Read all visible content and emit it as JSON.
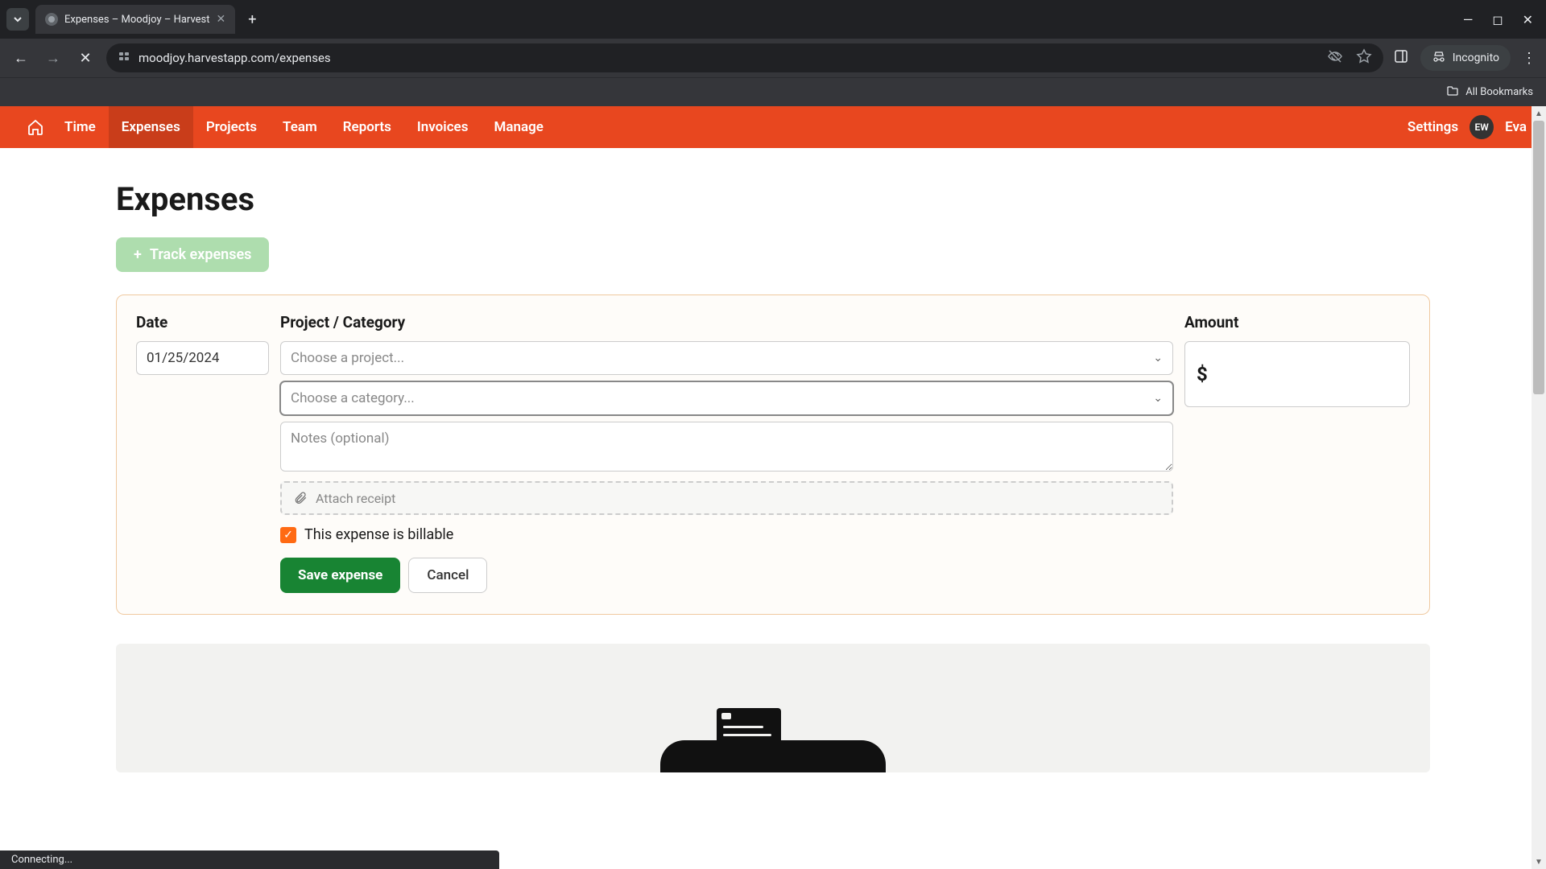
{
  "browser": {
    "tab_title": "Expenses – Moodjoy – Harvest",
    "url": "moodjoy.harvestapp.com/expenses",
    "incognito_label": "Incognito",
    "all_bookmarks": "All Bookmarks",
    "status_text": "Connecting..."
  },
  "nav": {
    "items": [
      "Time",
      "Expenses",
      "Projects",
      "Team",
      "Reports",
      "Invoices",
      "Manage"
    ],
    "active_index": 1,
    "settings": "Settings",
    "avatar_initials": "EW",
    "username": "Eva"
  },
  "page": {
    "title": "Expenses",
    "track_button": "Track expenses"
  },
  "form": {
    "labels": {
      "date": "Date",
      "project_category": "Project / Category",
      "amount": "Amount"
    },
    "date_value": "01/25/2024",
    "project_placeholder": "Choose a project...",
    "category_placeholder": "Choose a category...",
    "notes_placeholder": "Notes (optional)",
    "attach_label": "Attach receipt",
    "amount_currency": "$",
    "billable_label": "This expense is billable",
    "billable_checked": true,
    "save_label": "Save expense",
    "cancel_label": "Cancel"
  }
}
